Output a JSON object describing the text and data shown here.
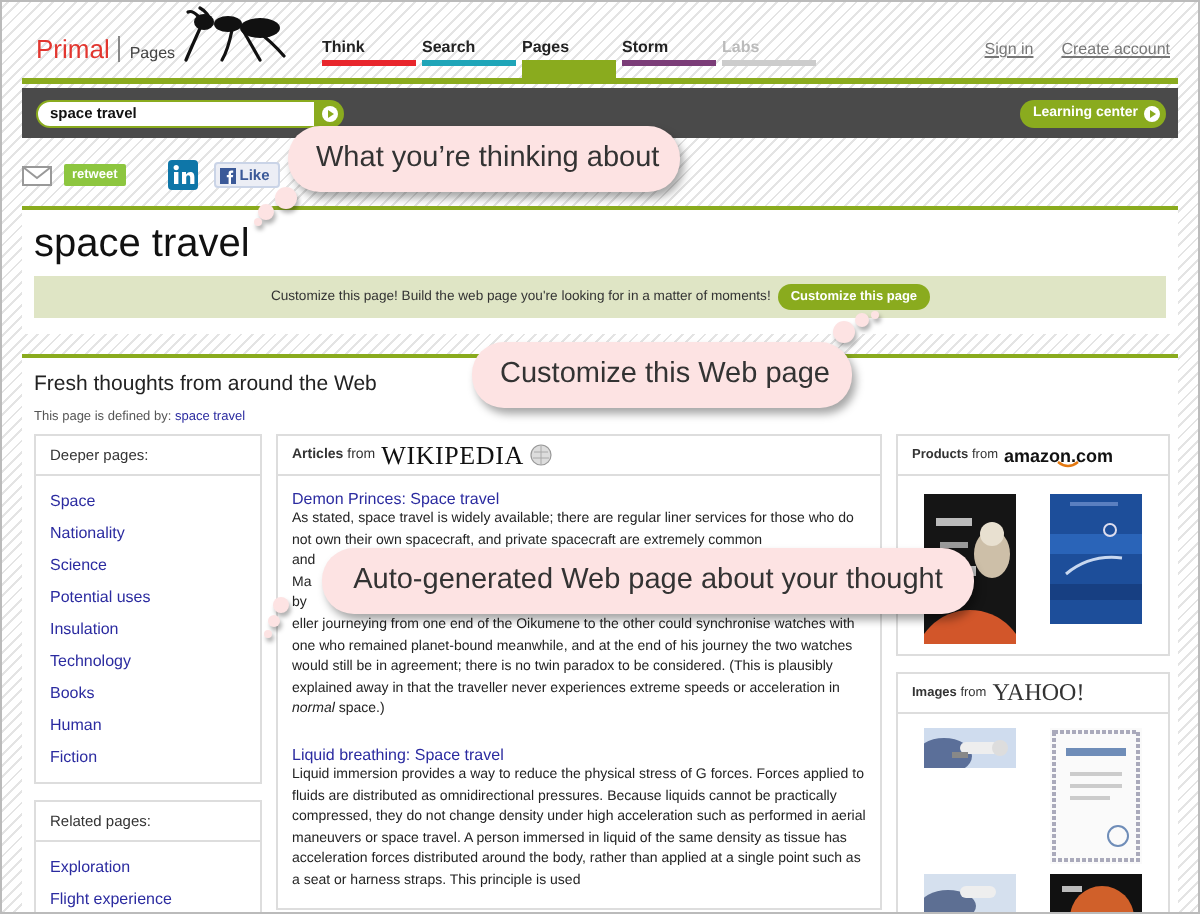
{
  "logo": {
    "brand": "Primal",
    "product": "Pages"
  },
  "nav_tabs": [
    {
      "label": "Think",
      "color": "#e8262c",
      "selected": false,
      "disabled": false
    },
    {
      "label": "Search",
      "color": "#1fa5b8",
      "selected": false,
      "disabled": false
    },
    {
      "label": "Pages",
      "color": "#8aab1e",
      "selected": true,
      "disabled": false
    },
    {
      "label": "Storm",
      "color": "#7b3d78",
      "selected": false,
      "disabled": false
    },
    {
      "label": "Labs",
      "color": "#cccccc",
      "selected": false,
      "disabled": true
    }
  ],
  "account_links": [
    "Sign in",
    "Create account"
  ],
  "search": {
    "value": "space travel"
  },
  "learning_center": "Learning center",
  "share": {
    "retweet": "retweet",
    "like": "Like"
  },
  "page_title": "space travel",
  "customize_bar": {
    "text": "Customize this page! Build the web page you're looking for in a matter of moments!",
    "button": "Customize this page"
  },
  "section_title": "Fresh thoughts from around the Web",
  "defined_by": {
    "label": "This page is defined by:",
    "link": "space travel"
  },
  "deeper_pages": {
    "title": "Deeper pages:",
    "items": [
      "Space",
      "Nationality",
      "Science",
      "Potential uses",
      "Insulation",
      "Technology",
      "Books",
      "Human",
      "Fiction"
    ]
  },
  "related_pages": {
    "title": "Related pages:",
    "items": [
      "Exploration",
      "Flight experience"
    ]
  },
  "articles": {
    "label": "**Articles** from",
    "source": "WIKIPEDIA",
    "items": [
      {
        "title": "Demon Princes: Space travel",
        "text_before": "As stated, space travel is widely available; there are regular liner services for those who do not own their own spacecraft, and private spacecraft are extremely common",
        "fragments": [
          "and",
          "Ma",
          "by"
        ],
        "text_after": "eller journeying from one end of the Oikumene to the other could synchronise watches with one who remained planet-bound meanwhile, and at the end of his journey the two watches would still be in agreement; there is no twin paradox to be considered. (This is plausibly explained away in that the traveller never experiences extreme speeds or acceleration in *normal* space.)"
      },
      {
        "title": "Liquid breathing: Space travel",
        "text": "Liquid immersion provides a way to reduce the physical stress of G forces. Forces applied to fluids are distributed as omnidirectional pressures. Because liquids cannot be practically compressed, they do not change density under high acceleration such as performed in aerial maneuvers or space travel. A person immersed in liquid of the same density as tissue has acceleration forces distributed around the body, rather than applied at a single point such as a seat or harness straps. This principle is used"
      }
    ]
  },
  "products": {
    "label": "**Products** from",
    "source": "amazon.com"
  },
  "images": {
    "label": "**Images** from",
    "source": "YAHOO!"
  },
  "callouts": [
    "What you’re thinking about",
    "Customize this Web page",
    "Auto-generated Web page about your thought"
  ]
}
